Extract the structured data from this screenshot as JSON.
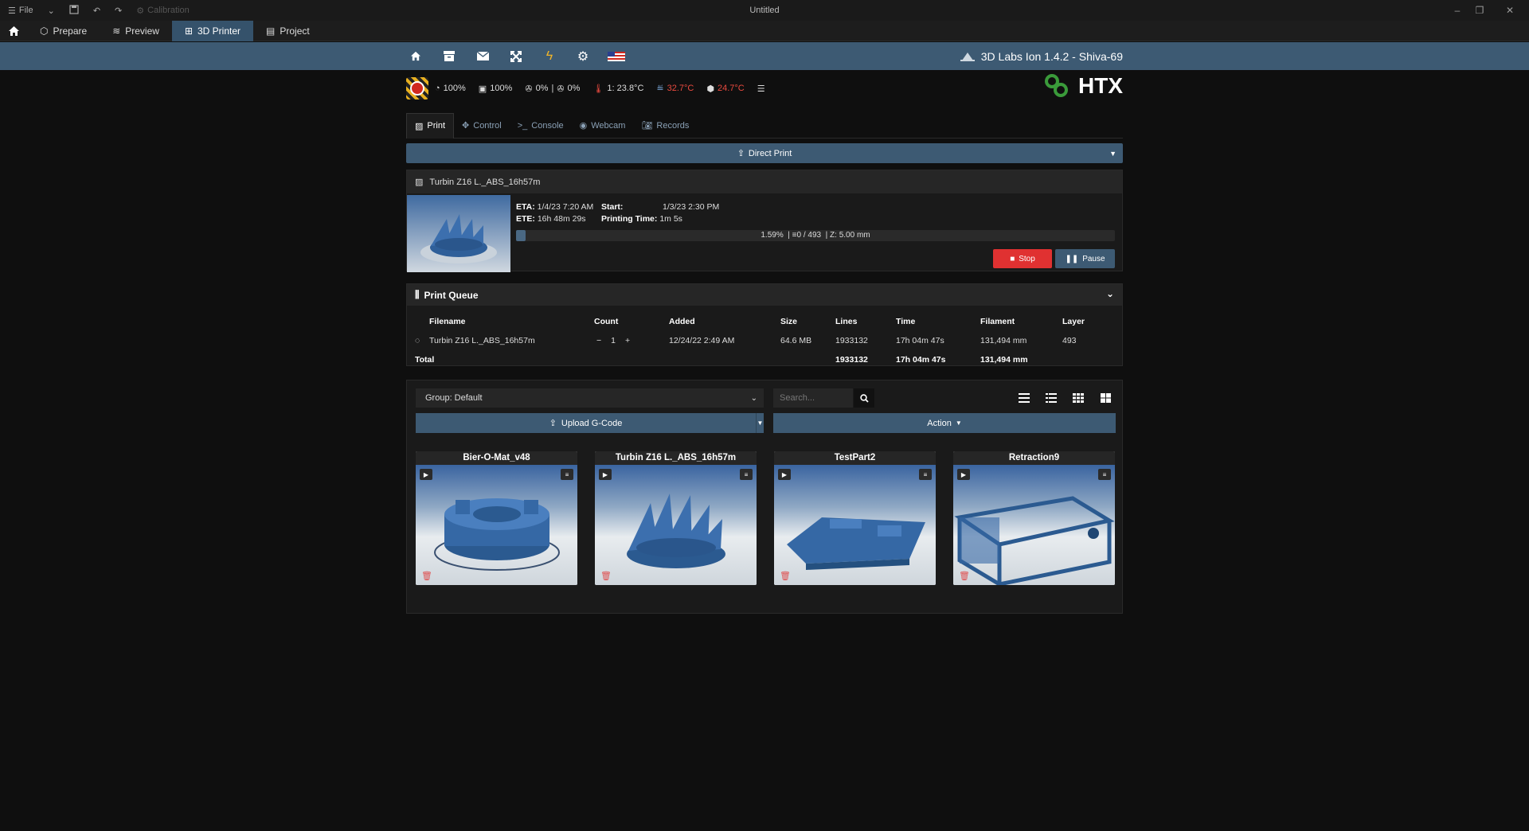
{
  "titlebar": {
    "file_label": "File",
    "calibration_label": "Calibration",
    "title": "Untitled"
  },
  "tabs": [
    {
      "label": "Prepare"
    },
    {
      "label": "Preview"
    },
    {
      "label": "3D Printer"
    },
    {
      "label": "Project"
    }
  ],
  "navbar": {
    "printer_name": "3D Labs Ion 1.4.2 - Shiva-69",
    "icons": [
      "home-icon",
      "archive-icon",
      "envelope-icon",
      "fullscreen-icon",
      "lightning-icon",
      "gear-icon",
      "us-flag-icon"
    ]
  },
  "status": {
    "speed": "100%",
    "flow": "100%",
    "fan1": "0%",
    "fan2": "0%",
    "extruder_temp": "1: 23.8°C",
    "bed_temp": "32.7°C",
    "chamber_temp": "24.7°C",
    "logo_text": "HTX",
    "alert_color": "#d0291f",
    "warn_color": "#e94a3f"
  },
  "subtabs": [
    {
      "label": "Print"
    },
    {
      "label": "Control"
    },
    {
      "label": "Console"
    },
    {
      "label": "Webcam"
    },
    {
      "label": "Records"
    }
  ],
  "direct_print_label": "Direct Print",
  "job": {
    "name": "Turbin Z16 L._ABS_16h57m",
    "eta_label": "ETA:",
    "eta": "1/4/23 7:20 AM",
    "ete_label": "ETE:",
    "ete": "16h 48m 29s",
    "start_label": "Start:",
    "start": "1/3/23 2:30 PM",
    "printing_time_label": "Printing Time:",
    "printing_time": "1m 5s",
    "progress_text": "1.59%",
    "progress_fraction": 0.0159,
    "layers": "0 / 493",
    "z": "Z: 5.00 mm",
    "stop_label": "Stop",
    "pause_label": "Pause"
  },
  "queue": {
    "title": "Print Queue",
    "headers": {
      "filename": "Filename",
      "count": "Count",
      "added": "Added",
      "size": "Size",
      "lines": "Lines",
      "time": "Time",
      "filament": "Filament",
      "layer": "Layer"
    },
    "rows": [
      {
        "filename": "Turbin Z16 L._ABS_16h57m",
        "count_minus": "−",
        "count": "1",
        "count_plus": "+",
        "added": "12/24/22 2:49 AM",
        "size": "64.6 MB",
        "lines": "1933132",
        "time": "17h 04m 47s",
        "filament": "131,494 mm",
        "layer": "493"
      }
    ],
    "total": {
      "label": "Total",
      "lines": "1933132",
      "time": "17h 04m 47s",
      "filament": "131,494 mm"
    }
  },
  "files": {
    "group": "Group: Default",
    "search_placeholder": "Search...",
    "upload_label": "Upload G-Code",
    "action_label": "Action",
    "cards": [
      {
        "title": "Bier-O-Mat_v48"
      },
      {
        "title": "Turbin Z16 L._ABS_16h57m"
      },
      {
        "title": "TestPart2"
      },
      {
        "title": "Retraction9"
      }
    ]
  }
}
